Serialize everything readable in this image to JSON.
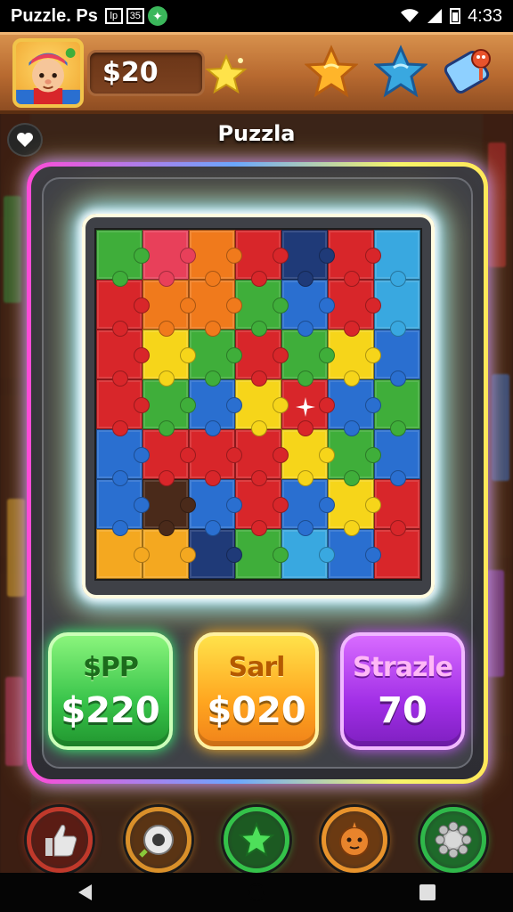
{
  "status_bar": {
    "app_name": "Puzzle. Ps",
    "icon1": "lp",
    "icon2": "35",
    "time": "4:33"
  },
  "header": {
    "coins": "$20"
  },
  "title": "Puzzla",
  "board": {
    "rows": 7,
    "cols": 7,
    "colors": {
      "green": "#3fae3a",
      "pink": "#e8405a",
      "orange": "#f07a1c",
      "red": "#d8262a",
      "navy": "#1f3a78",
      "sky": "#39a8e0",
      "yellow": "#f6d51a",
      "blue": "#2a6fd0",
      "brown": "#4a2a1a",
      "amber": "#f4a820"
    },
    "grid": [
      [
        "green",
        "pink",
        "orange",
        "red",
        "navy",
        "red",
        "sky"
      ],
      [
        "red",
        "orange",
        "orange",
        "green",
        "blue",
        "red",
        "sky"
      ],
      [
        "red",
        "yellow",
        "green",
        "red",
        "green",
        "yellow",
        "blue"
      ],
      [
        "red",
        "green",
        "blue",
        "yellow",
        "red",
        "blue",
        "green"
      ],
      [
        "blue",
        "red",
        "red",
        "red",
        "yellow",
        "green",
        "blue"
      ],
      [
        "blue",
        "brown",
        "blue",
        "red",
        "blue",
        "yellow",
        "red"
      ],
      [
        "amber",
        "amber",
        "navy",
        "green",
        "sky",
        "blue",
        "red"
      ]
    ]
  },
  "scores": [
    {
      "label": "$PP",
      "value": "$220",
      "color": "green"
    },
    {
      "label": "Sarl",
      "value": "$020",
      "color": "orange"
    },
    {
      "label": "Strazle",
      "value": "70",
      "color": "purple"
    }
  ],
  "tools": [
    {
      "icon": "thumbs-up-icon",
      "ring": "#c0392b",
      "fill": "#5a1c14"
    },
    {
      "icon": "tape-icon",
      "ring": "#d9902a",
      "fill": "#5a3414"
    },
    {
      "icon": "star-icon",
      "ring": "#34c24a",
      "fill": "#1c5a22"
    },
    {
      "icon": "creature-icon",
      "ring": "#e8932c",
      "fill": "#6b3a12"
    },
    {
      "icon": "gear-icon",
      "ring": "#2fb84a",
      "fill": "#1e6a2a"
    }
  ]
}
